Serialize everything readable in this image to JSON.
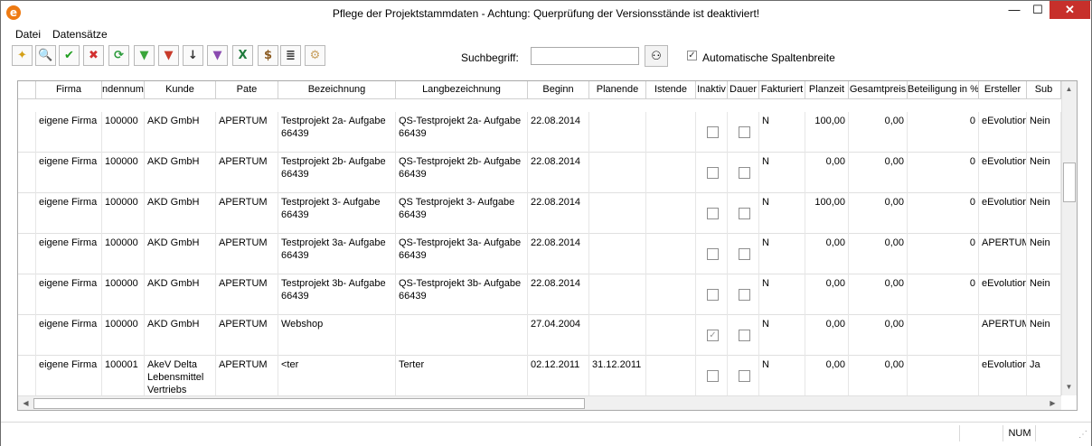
{
  "window": {
    "title": "Pflege der Projektstammdaten - Achtung: Querprüfung der Versionsstände ist deaktiviert!",
    "min_glyph": "—",
    "max_glyph": "☐",
    "close_glyph": "✕",
    "app_icon_glyph": "e"
  },
  "menu": {
    "file": "Datei",
    "records": "Datensätze"
  },
  "toolbar": {
    "buttons": [
      {
        "icon": "new-icon",
        "glyph": "✦",
        "color": "#d4a017"
      },
      {
        "icon": "search-icon",
        "glyph": "🔍",
        "color": "#1f5fb0"
      },
      {
        "icon": "check-icon",
        "glyph": "✔",
        "color": "#1e9e1e"
      },
      {
        "icon": "cancel-icon",
        "glyph": "✖",
        "color": "#d23030"
      },
      {
        "icon": "refresh-icon",
        "glyph": "⟳",
        "color": "#2a9a3a"
      },
      {
        "icon": "filter-icon",
        "glyph": "▼",
        "color": "#3aa53a"
      },
      {
        "icon": "remove-filter-icon",
        "glyph": "▼",
        "color": "#c83a2a"
      },
      {
        "icon": "sort-az-icon",
        "glyph": "↓",
        "color": "#333333"
      },
      {
        "icon": "filter-settings-icon",
        "glyph": "▼",
        "color": "#8a4ab0"
      },
      {
        "icon": "excel-export-icon",
        "glyph": "X",
        "color": "#1e7a3c"
      },
      {
        "icon": "money-bag-icon",
        "glyph": "$",
        "color": "#8a5a20"
      },
      {
        "icon": "list-icon",
        "glyph": "≣",
        "color": "#333333"
      },
      {
        "icon": "settings-icon",
        "glyph": "⚙",
        "color": "#c8a060"
      }
    ]
  },
  "search": {
    "label": "Suchbegriff:",
    "value": "",
    "binoculars_glyph": "⚇",
    "auto_width_label": "Automatische Spaltenbreite",
    "auto_width_checked": true
  },
  "grid": {
    "columns": [
      "Firma",
      "ndennumn",
      "Kunde",
      "Pate",
      "Bezeichnung",
      "Langbezeichnung",
      "Beginn",
      "Planende",
      "Istende",
      "Inaktiv",
      "Dauer",
      "Fakturiert",
      "Planzeit",
      "Gesamtpreis",
      "Beteiligung in %",
      "Ersteller",
      "Sub"
    ],
    "rows": [
      {
        "firma": "eigene Firma",
        "nr": "100000",
        "kunde": "AKD GmbH",
        "pate": "APERTUM",
        "bez": "Testprojekt 2a- Aufgabe 66439",
        "lang": "QS-Testprojekt 2a- Aufgabe 66439",
        "beginn": "22.08.2014",
        "planende": "",
        "istende": "",
        "inaktiv": false,
        "dauer": false,
        "fakt": "N",
        "planzeit": "100,00",
        "gesamt": "0,00",
        "beteil": "0",
        "ersteller": "eEvolution",
        "sub": "Nein"
      },
      {
        "firma": "eigene Firma",
        "nr": "100000",
        "kunde": "AKD GmbH",
        "pate": "APERTUM",
        "bez": "Testprojekt 2b- Aufgabe 66439",
        "lang": "QS-Testprojekt 2b- Aufgabe 66439",
        "beginn": "22.08.2014",
        "planende": "",
        "istende": "",
        "inaktiv": false,
        "dauer": false,
        "fakt": "N",
        "planzeit": "0,00",
        "gesamt": "0,00",
        "beteil": "0",
        "ersteller": "eEvolution",
        "sub": "Nein"
      },
      {
        "firma": "eigene Firma",
        "nr": "100000",
        "kunde": "AKD GmbH",
        "pate": "APERTUM",
        "bez": "Testprojekt 3- Aufgabe 66439",
        "lang": "QS Testprojekt 3- Aufgabe 66439",
        "beginn": "22.08.2014",
        "planende": "",
        "istende": "",
        "inaktiv": false,
        "dauer": false,
        "fakt": "N",
        "planzeit": "100,00",
        "gesamt": "0,00",
        "beteil": "0",
        "ersteller": "eEvolution",
        "sub": "Nein"
      },
      {
        "firma": "eigene Firma",
        "nr": "100000",
        "kunde": "AKD GmbH",
        "pate": "APERTUM",
        "bez": "Testprojekt 3a- Aufgabe 66439",
        "lang": "QS-Testprojekt 3a- Aufgabe 66439",
        "beginn": "22.08.2014",
        "planende": "",
        "istende": "",
        "inaktiv": false,
        "dauer": false,
        "fakt": "N",
        "planzeit": "0,00",
        "gesamt": "0,00",
        "beteil": "0",
        "ersteller": "APERTUM",
        "sub": "Nein"
      },
      {
        "firma": "eigene Firma",
        "nr": "100000",
        "kunde": "AKD GmbH",
        "pate": "APERTUM",
        "bez": "Testprojekt 3b- Aufgabe 66439",
        "lang": "QS-Testprojekt 3b- Aufgabe 66439",
        "beginn": "22.08.2014",
        "planende": "",
        "istende": "",
        "inaktiv": false,
        "dauer": false,
        "fakt": "N",
        "planzeit": "0,00",
        "gesamt": "0,00",
        "beteil": "0",
        "ersteller": "eEvolution",
        "sub": "Nein"
      },
      {
        "firma": "eigene Firma",
        "nr": "100000",
        "kunde": "AKD GmbH",
        "pate": "APERTUM",
        "bez": "Webshop",
        "lang": "",
        "beginn": "27.04.2004",
        "planende": "",
        "istende": "",
        "inaktiv": true,
        "dauer": false,
        "fakt": "N",
        "planzeit": "0,00",
        "gesamt": "0,00",
        "beteil": "",
        "ersteller": "APERTUM",
        "sub": "Nein"
      },
      {
        "firma": "eigene Firma",
        "nr": "100001",
        "kunde": "AkeV Delta Lebensmittel Vertriebs",
        "pate": "APERTUM",
        "bez": "<ter",
        "lang": "Terter",
        "beginn": "02.12.2011",
        "planende": "31.12.2011",
        "istende": "",
        "inaktiv": false,
        "dauer": false,
        "fakt": "N",
        "planzeit": "0,00",
        "gesamt": "0,00",
        "beteil": "",
        "ersteller": "eEvolution",
        "sub": "Ja"
      }
    ]
  },
  "status": {
    "num": "NUM"
  }
}
